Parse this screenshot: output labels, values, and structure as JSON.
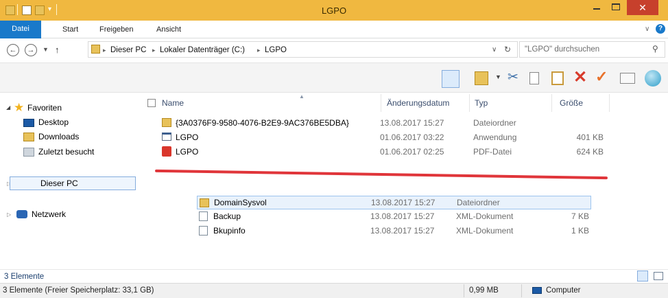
{
  "window": {
    "title": "LGPO"
  },
  "ribbon": {
    "tabs": [
      "Datei",
      "Start",
      "Freigeben",
      "Ansicht"
    ]
  },
  "address": {
    "crumbs": [
      "Dieser PC",
      "Lokaler Datenträger (C:)",
      "LGPO"
    ],
    "search_placeholder": "\"LGPO\" durchsuchen"
  },
  "nav": {
    "favorites": "Favoriten",
    "items": [
      "Desktop",
      "Downloads",
      "Zuletzt besucht"
    ],
    "this_pc": "Dieser PC",
    "network": "Netzwerk"
  },
  "columns": {
    "name": "Name",
    "date": "Änderungsdatum",
    "type": "Typ",
    "size": "Größe"
  },
  "files_top": [
    {
      "name": "{3A0376F9-9580-4076-B2E9-9AC376BE5DBA}",
      "date": "13.08.2017 15:27",
      "type": "Dateiordner",
      "size": "",
      "icon": "folder-icon"
    },
    {
      "name": "LGPO",
      "date": "01.06.2017 03:22",
      "type": "Anwendung",
      "size": "401 KB",
      "icon": "application-icon"
    },
    {
      "name": "LGPO",
      "date": "01.06.2017 02:25",
      "type": "PDF-Datei",
      "size": "624 KB",
      "icon": "pdf-icon"
    }
  ],
  "files_bottom": [
    {
      "name": "DomainSysvol",
      "date": "13.08.2017 15:27",
      "type": "Dateiordner",
      "size": "",
      "icon": "folder-icon"
    },
    {
      "name": "Backup",
      "date": "13.08.2017 15:27",
      "type": "XML-Dokument",
      "size": "7 KB",
      "icon": "xml-icon"
    },
    {
      "name": "Bkupinfo",
      "date": "13.08.2017 15:27",
      "type": "XML-Dokument",
      "size": "1 KB",
      "icon": "xml-icon"
    }
  ],
  "status": {
    "count": "3 Elemente",
    "details": "3 Elemente (Freier Speicherplatz: 33,1 GB)",
    "size": "0,99 MB",
    "location": "Computer"
  },
  "colors": {
    "titlebar": "#f0b840",
    "accent": "#1979ca",
    "close": "#c7402c",
    "separator": "#e0353a"
  }
}
